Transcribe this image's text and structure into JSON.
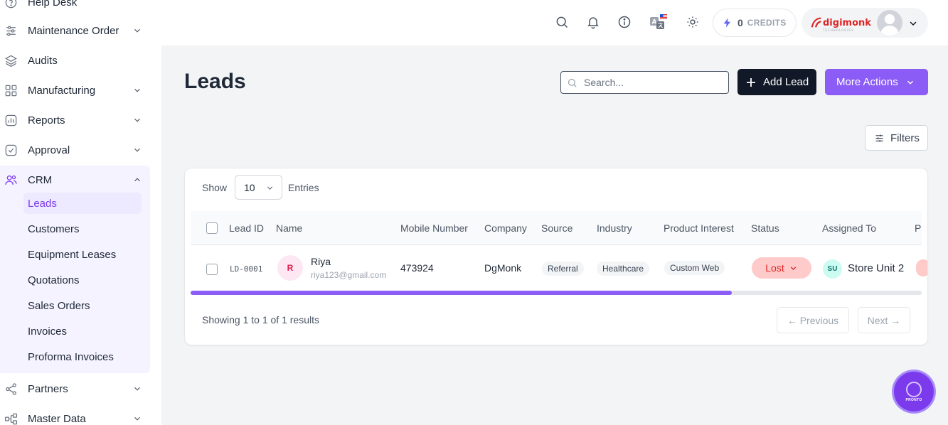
{
  "sidebar": {
    "items": [
      {
        "label": "Help Desk"
      },
      {
        "label": "Maintenance Order"
      },
      {
        "label": "Audits"
      },
      {
        "label": "Manufacturing"
      },
      {
        "label": "Reports"
      },
      {
        "label": "Approval"
      },
      {
        "label": "CRM"
      },
      {
        "label": "Partners"
      },
      {
        "label": "Master Data"
      }
    ],
    "crm_sub": [
      "Leads",
      "Customers",
      "Equipment Leases",
      "Quotations",
      "Sales Orders",
      "Invoices",
      "Proforma Invoices"
    ]
  },
  "topbar": {
    "credits_count": "0",
    "credits_label": "CREDITS",
    "brand": "digimonk",
    "brand_tagline": "TECHNOLOGIES"
  },
  "page": {
    "title": "Leads",
    "search_placeholder": "Search...",
    "add_label": "Add Lead",
    "more_label": "More Actions",
    "filters_label": "Filters"
  },
  "table": {
    "show_label": "Show",
    "entries_value": "10",
    "entries_label": "Entries",
    "headers": [
      "Lead ID",
      "Name",
      "Mobile Number",
      "Company",
      "Source",
      "Industry",
      "Product Interest",
      "Status",
      "Assigned To",
      "P"
    ],
    "rows": [
      {
        "lead_id": "LD-0001",
        "initial": "R",
        "name": "Riya",
        "email": "riya123@gmail.com",
        "mobile": "473924",
        "company": "DgMonk",
        "source": "Referral",
        "industry": "Healthcare",
        "product_interest": "Custom Web",
        "status": "Lost",
        "assigned_initials": "SU",
        "assigned_to": "Store Unit 2"
      }
    ],
    "scroll_fraction": 0.74,
    "results_text": "Showing 1 to 1 of 1 results",
    "prev_label": "← Previous",
    "next_label": "Next →"
  },
  "fab": {
    "label": "PRONTO"
  },
  "colors": {
    "accent": "#8b5cf6",
    "dark_button": "#111827",
    "status_lost_bg": "#fecaca",
    "status_lost_text": "#dc2626"
  }
}
